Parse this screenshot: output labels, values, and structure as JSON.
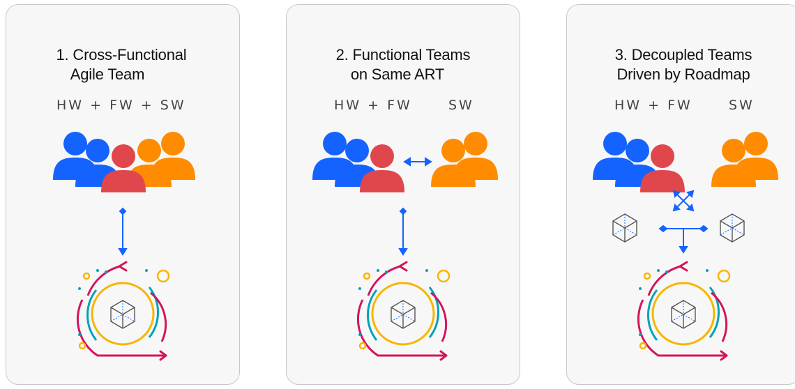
{
  "panels": [
    {
      "number": "1.",
      "title_line1": "Cross-Functional",
      "title_line2": "Agile Team",
      "labels": [
        "HW + FW + SW"
      ]
    },
    {
      "number": "2.",
      "title_line1": "Functional Teams",
      "title_line2": "on Same ART",
      "labels": [
        "HW + FW",
        "SW"
      ]
    },
    {
      "number": "3.",
      "title_line1": "Decoupled Teams",
      "title_line2": "Driven by Roadmap",
      "labels": [
        "HW + FW",
        "SW"
      ]
    }
  ],
  "colors": {
    "blue": "#1463ff",
    "red": "#e0474c",
    "orange": "#ff8c00",
    "arrow": "#1463ff",
    "crimson": "#d4145a",
    "teal": "#00a3b5",
    "gold": "#f7b500"
  },
  "icons": [
    "people-icon",
    "bidirectional-arrow-icon",
    "cube-icon",
    "iteration-cycle-icon"
  ]
}
